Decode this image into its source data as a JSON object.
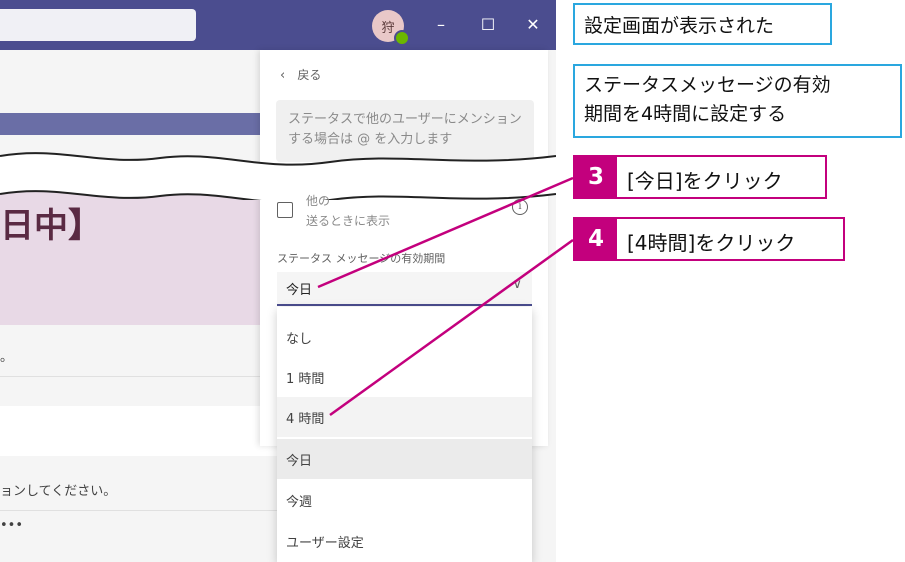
{
  "window": {
    "avatar_text": "狩",
    "minimize_glyph": "–",
    "maximize_glyph": "☐",
    "close_glyph": "✕"
  },
  "background_pane": {
    "heading_fragment": "日中】",
    "text_1": "。",
    "text_2": "ョンしてください。",
    "text_3": "•••"
  },
  "status_panel": {
    "back_label": "戻る",
    "message_placeholder": "ステータスで他のユーザーにメンションする場合は @ を入力します",
    "checkbox_label_1": "他の",
    "checkbox_label_2": "送るときに表示",
    "duration_label": "ステータス メッセージの有効期間",
    "duration_selected": "今日",
    "duration_options": [
      "なし",
      "1 時間",
      "4 時間",
      "今日",
      "今週",
      "ユーザー設定"
    ]
  },
  "annotations": {
    "callout_1": "設定画面が表示された",
    "callout_2_line1": "ステータスメッセージの有効",
    "callout_2_line2": "期間を4時間に設定する",
    "step_3_number": "3",
    "step_3_text": "[今日]をクリック",
    "step_4_number": "4",
    "step_4_text": "[4時間]をクリック"
  },
  "colors": {
    "titlebar": "#4b4d8f",
    "step_accent": "#c3007d",
    "callout_border": "#2aa7df"
  }
}
